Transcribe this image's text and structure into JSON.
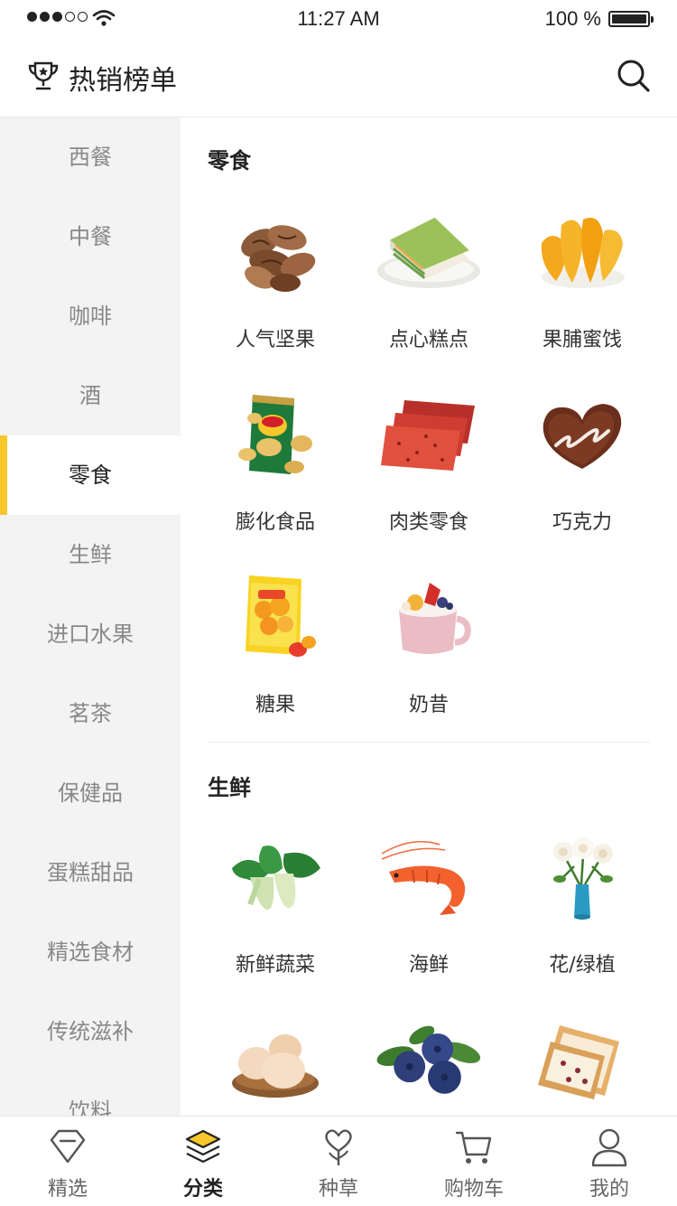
{
  "status_bar": {
    "time": "11:27 AM",
    "battery": "100 %"
  },
  "header": {
    "title": "热销榜单",
    "icon": "trophy-icon",
    "search_icon": "search-icon"
  },
  "sidebar": {
    "items": [
      {
        "label": "西餐"
      },
      {
        "label": "中餐"
      },
      {
        "label": "咖啡"
      },
      {
        "label": "酒"
      },
      {
        "label": "零食",
        "active": true
      },
      {
        "label": "生鲜"
      },
      {
        "label": "进口水果"
      },
      {
        "label": "茗茶"
      },
      {
        "label": "保健品"
      },
      {
        "label": "蛋糕甜品"
      },
      {
        "label": "精选食材"
      },
      {
        "label": "传统滋补"
      },
      {
        "label": "饮料"
      }
    ],
    "accent": "#f7c72b"
  },
  "sections": [
    {
      "title": "零食",
      "items": [
        {
          "label": "人气坚果",
          "icon": "nuts-icon"
        },
        {
          "label": "点心糕点",
          "icon": "cake-slice-icon"
        },
        {
          "label": "果脯蜜饯",
          "icon": "dried-mango-icon"
        },
        {
          "label": "膨化食品",
          "icon": "chips-bag-icon"
        },
        {
          "label": "肉类零食",
          "icon": "jerky-icon"
        },
        {
          "label": "巧克力",
          "icon": "chocolate-icon"
        },
        {
          "label": "糖果",
          "icon": "candy-icon"
        },
        {
          "label": "奶昔",
          "icon": "milkshake-icon"
        }
      ]
    },
    {
      "title": "生鲜",
      "items": [
        {
          "label": "新鲜蔬菜",
          "icon": "bok-choy-icon"
        },
        {
          "label": "海鲜",
          "icon": "shrimp-icon"
        },
        {
          "label": "花/绿植",
          "icon": "flower-vase-icon"
        },
        {
          "label": "",
          "icon": "eggs-icon"
        },
        {
          "label": "",
          "icon": "blueberries-icon"
        },
        {
          "label": "",
          "icon": "bread-icon"
        }
      ]
    }
  ],
  "tabbar": {
    "items": [
      {
        "label": "精选",
        "icon": "diamond-icon"
      },
      {
        "label": "分类",
        "icon": "layers-icon",
        "active": true
      },
      {
        "label": "种草",
        "icon": "heart-sprout-icon"
      },
      {
        "label": "购物车",
        "icon": "cart-icon"
      },
      {
        "label": "我的",
        "icon": "user-icon"
      }
    ]
  }
}
